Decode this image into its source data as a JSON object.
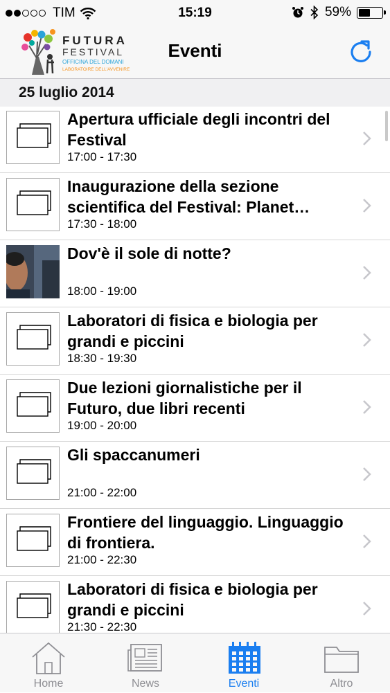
{
  "status_bar": {
    "carrier": "TIM",
    "time": "15:19",
    "battery": "59%",
    "battery_level": 0.59,
    "signal_bars_filled": 2,
    "signal_bars_total": 5,
    "icons": [
      "wifi-icon",
      "alarm-icon",
      "bluetooth-icon",
      "battery-icon"
    ]
  },
  "nav": {
    "title": "Eventi",
    "logo": {
      "line1": "FUTURA",
      "line2": "FESTIVAL",
      "line3": "OFFICINA DEL DOMANI",
      "line4": "LABORATOIRE DELL'AVVENIRE"
    },
    "refresh_icon": "refresh-icon"
  },
  "section": {
    "date": "25 luglio 2014"
  },
  "events": [
    {
      "title": "Apertura ufficiale degli incontri del Festival",
      "time": "17:00 - 17:30",
      "thumb": "placeholder"
    },
    {
      "title": "Inaugurazione della sezione scientifica del Festival: Planet…",
      "time": "17:30 - 18:00",
      "thumb": "placeholder"
    },
    {
      "title": "Dov'è il sole di notte?",
      "time": "18:00 - 19:00",
      "thumb": "photo"
    },
    {
      "title": "Laboratori di fisica e biologia per grandi e piccini",
      "time": "18:30 - 19:30",
      "thumb": "placeholder"
    },
    {
      "title": "Due lezioni giornalistiche per il Futuro, due libri recenti",
      "time": "19:00 - 20:00",
      "thumb": "placeholder"
    },
    {
      "title": "Gli spaccanumeri",
      "time": "21:00 - 22:00",
      "thumb": "placeholder"
    },
    {
      "title": "Frontiere del linguaggio. Linguaggio di frontiera.",
      "time": "21:00 - 22:30",
      "thumb": "placeholder"
    },
    {
      "title": "Laboratori di fisica e biologia per grandi e piccini",
      "time": "21:30 - 22:30",
      "thumb": "placeholder"
    }
  ],
  "tabs": [
    {
      "label": "Home",
      "icon": "home-icon",
      "active": false
    },
    {
      "label": "News",
      "icon": "news-icon",
      "active": false
    },
    {
      "label": "Eventi",
      "icon": "calendar-icon",
      "active": true
    },
    {
      "label": "Altro",
      "icon": "folder-icon",
      "active": false
    }
  ],
  "colors": {
    "accent": "#1a7ef0",
    "inactive_tab": "#8e8e93",
    "bar_bg": "#f7f7f7",
    "section_bg": "#f0f0f2",
    "separator": "#d6d6d6"
  }
}
